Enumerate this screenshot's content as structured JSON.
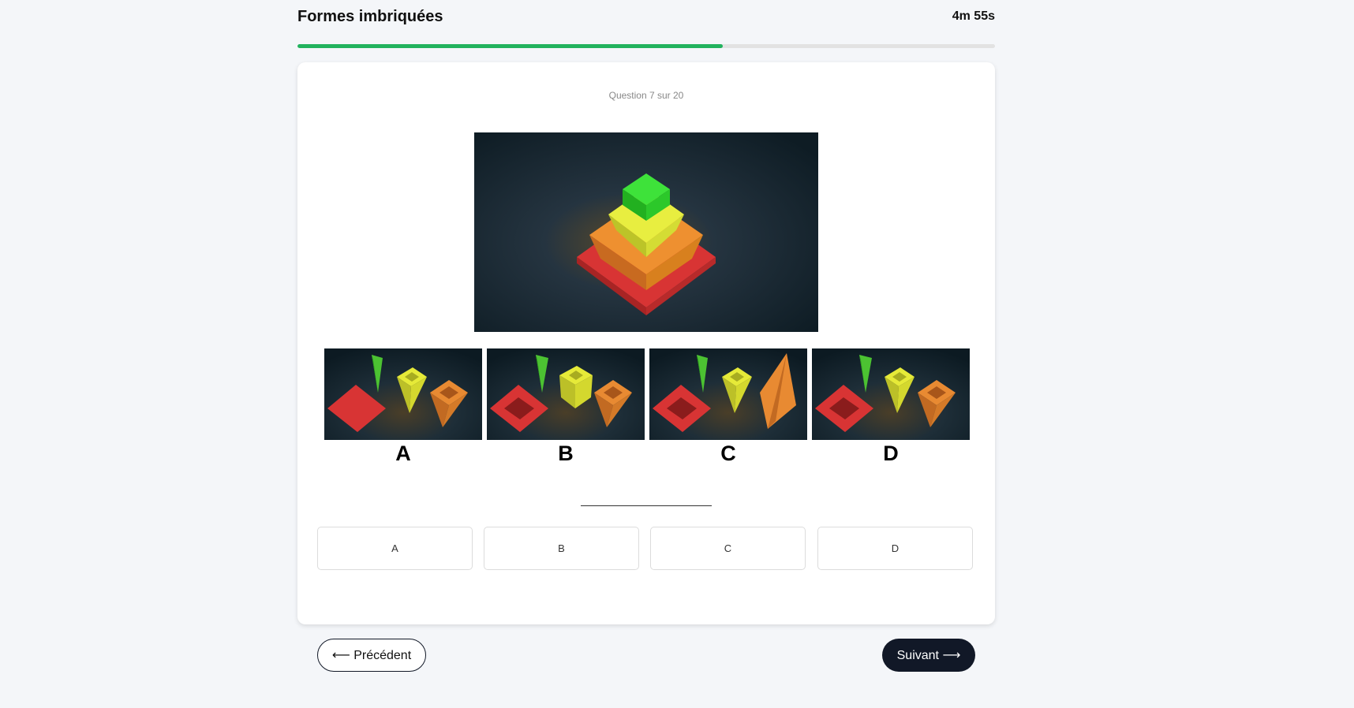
{
  "header": {
    "title": "Formes imbriquées",
    "timer": "4m 55s",
    "progress": 0.61
  },
  "question": {
    "counter": "Question 7 sur 20",
    "main_image": "nested-pyramid-shapes",
    "option_images": [
      {
        "label": "A"
      },
      {
        "label": "B"
      },
      {
        "label": "C"
      },
      {
        "label": "D"
      }
    ]
  },
  "answers": [
    {
      "label": "A"
    },
    {
      "label": "B"
    },
    {
      "label": "C"
    },
    {
      "label": "D"
    }
  ],
  "nav": {
    "prev_label": "⟵ Précédent",
    "next_label": "Suivant ⟶"
  },
  "colors": {
    "accent_green": "#22b35e",
    "dark": "#111827"
  }
}
